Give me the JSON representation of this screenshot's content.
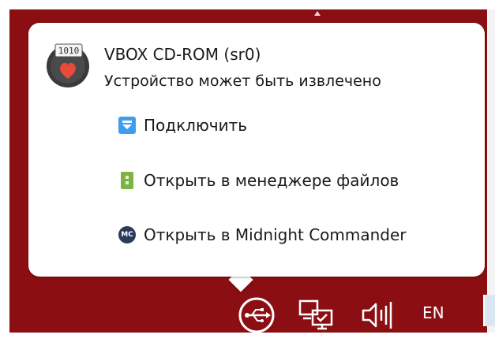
{
  "device": {
    "title": "VBOX CD-ROM (sr0)",
    "subtitle": "Устройство может быть извлечено",
    "icon_badge": "1010",
    "icon": "optical-disc-icon"
  },
  "actions": [
    {
      "label": "Подключить",
      "icon": "mount-icon"
    },
    {
      "label": "Открыть в менеджере файлов",
      "icon": "file-manager-icon"
    },
    {
      "label": "Открыть в Midnight Commander",
      "icon": "midnight-commander-icon",
      "icon_text": "MC"
    }
  ],
  "taskbar": {
    "language": "EN",
    "items": [
      "usb-icon",
      "display-icon",
      "volume-icon"
    ]
  },
  "colors": {
    "panel_background": "#8b0f12",
    "popup_background": "#ffffff",
    "mount_icon": "#3d9ef0",
    "file_manager_icon": "#7cb342",
    "midnight_commander_icon": "#2b3a5c"
  }
}
